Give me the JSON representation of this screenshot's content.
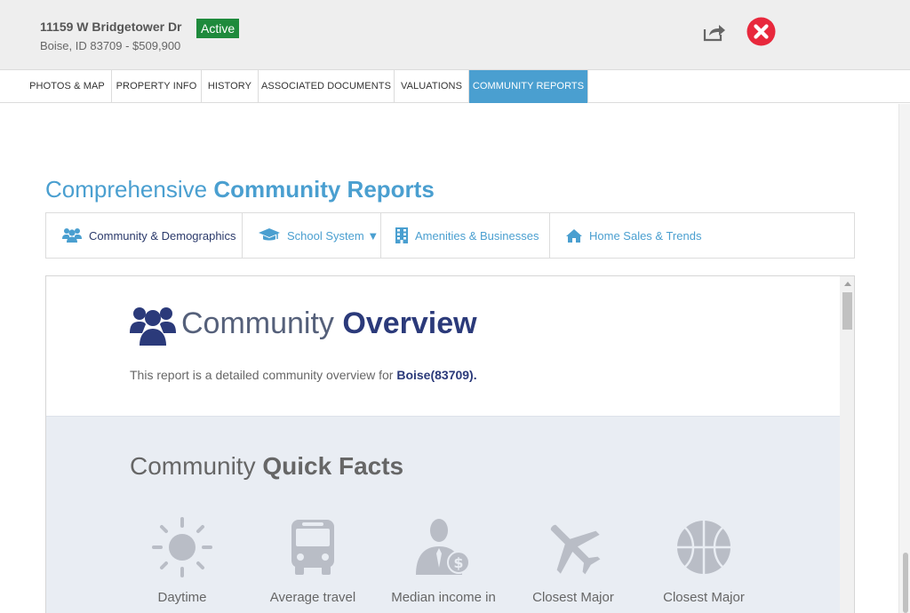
{
  "listing": {
    "address": "11159 W Bridgetower Dr",
    "status": "Active",
    "city_price": "Boise, ID 83709 - $509,900",
    "share_icon": "share-icon",
    "close_icon": "close-icon"
  },
  "tabs": [
    {
      "label": "PHOTOS & MAP"
    },
    {
      "label": "PROPERTY INFO"
    },
    {
      "label": "HISTORY"
    },
    {
      "label": "ASSOCIATED DOCUMENTS"
    },
    {
      "label": "VALUATIONS"
    },
    {
      "label": "COMMUNITY REPORTS",
      "active": true
    }
  ],
  "reports": {
    "heading_light": "Comprehensive ",
    "heading_bold": "Community Reports",
    "subnav": [
      {
        "label": "Community & Demographics",
        "icon": "users-icon"
      },
      {
        "label": "School System ▼",
        "icon": "graduation-cap-icon"
      },
      {
        "label": "Amenities & Businesses",
        "icon": "building-icon"
      },
      {
        "label": "Home Sales & Trends",
        "icon": "home-icon"
      }
    ]
  },
  "overview": {
    "title_light": "Community ",
    "title_bold": "Overview",
    "text_prefix": "This report is a detailed community overview for ",
    "text_place": "Boise(83709)."
  },
  "quick_facts": {
    "title_light": "Community ",
    "title_bold": "Quick Facts",
    "items": [
      {
        "label": "Daytime",
        "icon": "sun-icon"
      },
      {
        "label": "Average travel",
        "icon": "bus-icon"
      },
      {
        "label": "Median income in",
        "icon": "businessman-dollar-icon"
      },
      {
        "label": "Closest Major",
        "icon": "airplane-icon"
      },
      {
        "label": "Closest Major",
        "icon": "basketball-icon"
      }
    ]
  },
  "colors": {
    "accent": "#4a9fd0",
    "navy": "#2b3a7a",
    "active_badge": "#1e8a3c",
    "close": "#e8283c"
  }
}
